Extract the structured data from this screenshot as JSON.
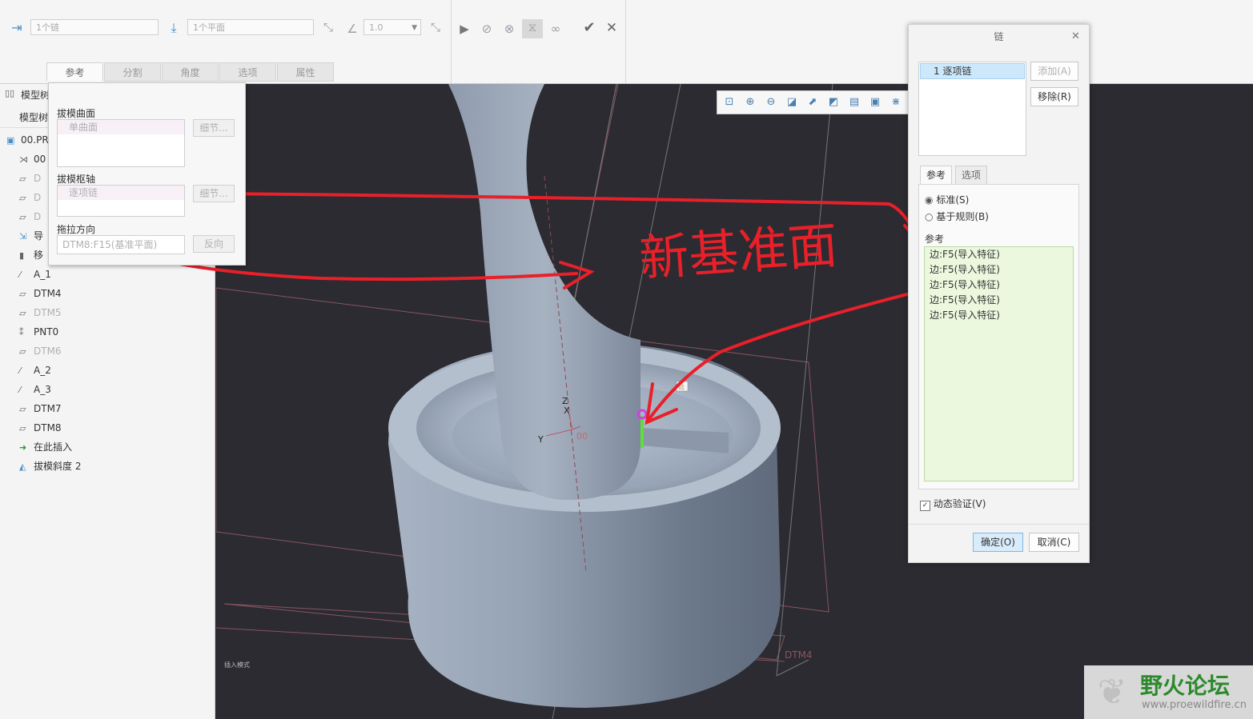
{
  "ribbon": {
    "chain_field": "1个链",
    "plane_field": "1个平面",
    "angle_value": "1.0",
    "tabs": [
      "参考",
      "分割",
      "角度",
      "选项",
      "属性"
    ]
  },
  "sidebar": {
    "header_row": "模型树",
    "header_tab": "模型树",
    "root": "00.PR",
    "items": [
      {
        "icon": "axis-point-icon",
        "label": "00",
        "dim": false
      },
      {
        "icon": "datum-plane-icon",
        "label": "D",
        "dim": true
      },
      {
        "icon": "datum-plane-icon",
        "label": "D",
        "dim": true
      },
      {
        "icon": "datum-plane-icon",
        "label": "D",
        "dim": true
      },
      {
        "icon": "import-feature-icon",
        "label": "导",
        "dim": false
      },
      {
        "icon": "move-icon",
        "label": "移",
        "dim": false
      },
      {
        "icon": "axis-icon",
        "label": "A_1",
        "dim": false
      },
      {
        "icon": "datum-plane-icon",
        "label": "DTM4",
        "dim": false
      },
      {
        "icon": "datum-plane-icon",
        "label": "DTM5",
        "dim": true
      },
      {
        "icon": "datum-point-icon",
        "label": "PNT0",
        "dim": false
      },
      {
        "icon": "datum-plane-icon",
        "label": "DTM6",
        "dim": true
      },
      {
        "icon": "axis-icon",
        "label": "A_2",
        "dim": false
      },
      {
        "icon": "axis-icon",
        "label": "A_3",
        "dim": false
      },
      {
        "icon": "datum-plane-icon",
        "label": "DTM7",
        "dim": false
      },
      {
        "icon": "datum-plane-icon",
        "label": "DTM8",
        "dim": false
      },
      {
        "icon": "insert-here-arrow-icon",
        "label": "在此插入",
        "dim": false
      },
      {
        "icon": "draft-feature-icon",
        "label": "拔模斜度 2",
        "dim": false
      }
    ]
  },
  "ref_panel": {
    "draft_surface_label": "拔模曲面",
    "draft_surface_value": "单曲面",
    "detail_btn": "细节...",
    "pivot_label": "拔模枢轴",
    "pivot_value": "逐项链",
    "pivot_detail_btn": "细节...",
    "pull_dir_label": "拖拉方向",
    "pull_dir_value": "DTM8:F15(基准平面)",
    "reverse_btn": "反向"
  },
  "viewport": {
    "annotation_text": "新基准面",
    "label_z": "Z",
    "label_x": "X",
    "label_y": "Y",
    "label_00": "00",
    "label_dtm4": "DTM4",
    "mini_text": "插入模式",
    "chain_tag": "链"
  },
  "dialog": {
    "title": "链",
    "chain_item": "1 逐项链",
    "add_btn": "添加(A)",
    "remove_btn": "移除(R)",
    "tab_ref": "参考",
    "tab_opt": "选项",
    "radio_standard": "标准(S)",
    "radio_rule": "基于规则(B)",
    "ref_label": "参考",
    "refs": [
      "边:F5(导入特征)",
      "边:F5(导入特征)",
      "边:F5(导入特征)",
      "边:F5(导入特征)",
      "边:F5(导入特征)"
    ],
    "dyn_verify": "动态验证(V)",
    "ok_btn": "确定(O)",
    "cancel_btn": "取消(C)"
  },
  "watermark": {
    "title": "野火论坛",
    "url": "www.proewildfire.cn"
  },
  "colors": {
    "annotation_red": "#e8202a",
    "selection_blue": "#cde8fb",
    "ref_list_green": "#ebf8de",
    "ok_button": "#d9ecfa"
  }
}
